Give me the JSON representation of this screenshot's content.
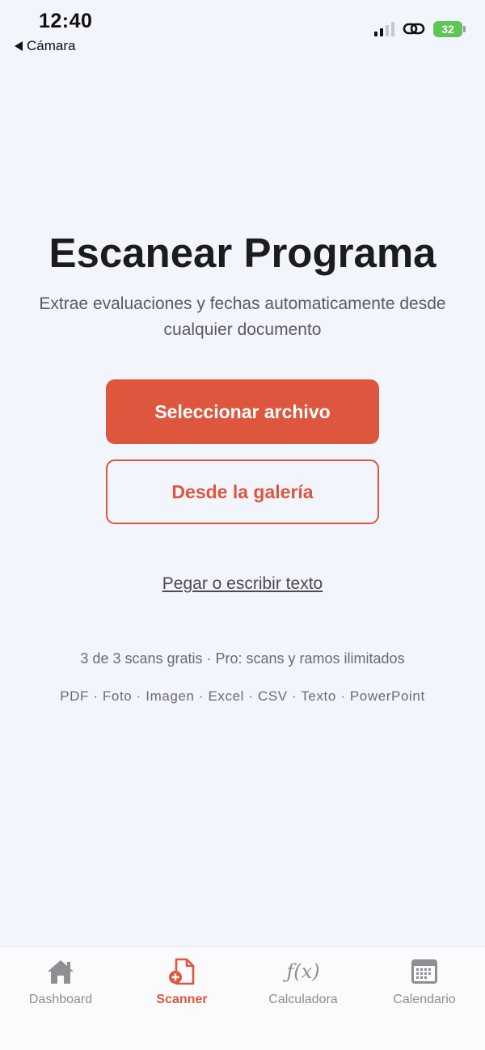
{
  "status": {
    "time": "12:40",
    "back_label": "Cámara",
    "battery": "32"
  },
  "main": {
    "title": "Escanear Programa",
    "subtitle": "Extrae evaluaciones y fechas automaticamente desde cualquier documento",
    "primary_button": "Seleccionar archivo",
    "secondary_button": "Desde la galería",
    "paste_link": "Pegar o escribir texto",
    "plan_info": "3 de 3 scans gratis · Pro: scans y ramos ilimitados",
    "formats": "PDF · Foto · Imagen · Excel · CSV · Texto · PowerPoint"
  },
  "tabbar": {
    "tabs": [
      {
        "label": "Dashboard",
        "icon": "home-icon",
        "active": false
      },
      {
        "label": "Scanner",
        "icon": "document-add-icon",
        "active": true
      },
      {
        "label": "Calculadora",
        "icon": "function-icon",
        "active": false
      },
      {
        "label": "Calendario",
        "icon": "calendar-icon",
        "active": false
      }
    ],
    "fx_glyph": "ƒ(x)"
  },
  "colors": {
    "accent": "#dd563d",
    "background": "#f3f5fc",
    "inactive_tab": "#8e8e93",
    "battery": "#5fc653"
  }
}
